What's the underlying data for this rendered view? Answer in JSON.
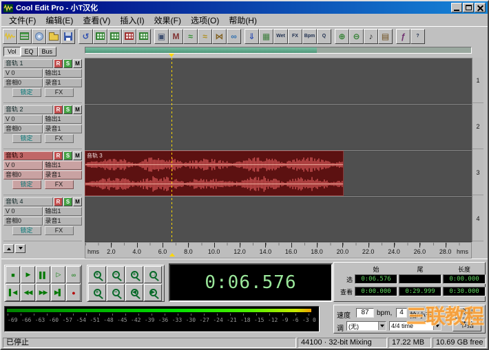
{
  "window": {
    "title": "Cool Edit Pro - 小T汉化"
  },
  "menu": {
    "items": [
      "文件(F)",
      "编辑(E)",
      "查看(V)",
      "插入(I)",
      "效果(F)",
      "选项(O)",
      "帮助(H)"
    ]
  },
  "toolbar": {
    "icons": [
      {
        "name": "waveform-view-icon",
        "kind": "wave",
        "color": "#e0c030"
      },
      {
        "name": "multitrack-view-icon",
        "kind": "bars"
      },
      {
        "name": "cd-project-view-icon",
        "kind": "disc"
      },
      {
        "name": "open-file-icon",
        "kind": "folder"
      },
      {
        "name": "save-session-icon",
        "kind": "floppy"
      },
      {
        "sep": true
      },
      {
        "name": "undo-icon",
        "kind": "glyph",
        "glyph": "↺",
        "color": "#3050b0"
      },
      {
        "name": "insert-wave-icon",
        "kind": "grid"
      },
      {
        "name": "clip-properties-icon",
        "kind": "grid"
      },
      {
        "name": "split-clip-icon",
        "kind": "gridred"
      },
      {
        "name": "merge-clip-icon",
        "kind": "grid"
      },
      {
        "sep": true
      },
      {
        "name": "lock-time-icon",
        "kind": "glyph",
        "glyph": "▣",
        "color": "#405070"
      },
      {
        "name": "mute-clip-icon",
        "kind": "glyph",
        "glyph": "M",
        "color": "#803030"
      },
      {
        "name": "volume-envelope-icon",
        "kind": "glyph",
        "glyph": "≈",
        "color": "#2f8f2f"
      },
      {
        "name": "pan-envelope-icon",
        "kind": "glyph",
        "glyph": "≈",
        "color": "#b09020"
      },
      {
        "name": "crossfade-icon",
        "kind": "glyph",
        "glyph": "⋈",
        "color": "#806020"
      },
      {
        "name": "loop-duplicate-icon",
        "kind": "glyph",
        "glyph": "∞",
        "color": "#2f6faf"
      },
      {
        "sep": true
      },
      {
        "name": "mixdown-icon",
        "kind": "glyph",
        "glyph": "⇓",
        "color": "#3050b0"
      },
      {
        "name": "mixer-icon",
        "kind": "glyph",
        "glyph": "▦",
        "color": "#3f7f3f"
      },
      {
        "name": "wet-dry-icon",
        "kind": "text",
        "glyph": "Wet",
        "color": "#203050"
      },
      {
        "name": "fx-rack-icon",
        "kind": "text",
        "glyph": "FX",
        "color": "#203050"
      },
      {
        "name": "bpm-icon",
        "kind": "text",
        "glyph": "Bpm",
        "color": "#203050"
      },
      {
        "name": "quantize-icon",
        "kind": "text",
        "glyph": "Q",
        "color": "#203050"
      },
      {
        "sep": true
      },
      {
        "name": "zoom-in-icon",
        "kind": "glyph",
        "glyph": "⊕",
        "color": "#2f7f2f"
      },
      {
        "name": "zoom-out-icon",
        "kind": "glyph",
        "glyph": "⊖",
        "color": "#2f7f2f"
      },
      {
        "name": "metronome-icon",
        "kind": "glyph",
        "glyph": "♪",
        "color": "#303030"
      },
      {
        "name": "cue-list-icon",
        "kind": "glyph",
        "glyph": "▤",
        "color": "#705020"
      },
      {
        "sep": true
      },
      {
        "name": "scripts-icon",
        "kind": "glyph",
        "glyph": "ƒ",
        "color": "#703070"
      },
      {
        "name": "help-icon",
        "kind": "text",
        "glyph": "?",
        "color": "#203050"
      }
    ]
  },
  "left_panel": {
    "tabs": [
      "Vol",
      "EQ",
      "Bus"
    ],
    "tracks": [
      {
        "name": "音轨 1",
        "record": "R",
        "solo": "S",
        "mute": "M",
        "volume": "V 0",
        "out": "输出1",
        "pan": "音相0",
        "rec": "录音1",
        "lock": "锁定",
        "fx": "FX",
        "selected": false
      },
      {
        "name": "音轨 2",
        "record": "R",
        "solo": "S",
        "mute": "M",
        "volume": "V 0",
        "out": "输出1",
        "pan": "音相0",
        "rec": "录音1",
        "lock": "锁定",
        "fx": "FX",
        "selected": false
      },
      {
        "name": "音轨 3",
        "record": "R",
        "solo": "S",
        "mute": "M",
        "volume": "V 0",
        "out": "输出1",
        "pan": "音相0",
        "rec": "录音1",
        "lock": "锁定",
        "fx": "FX",
        "selected": true
      },
      {
        "name": "音轨 4",
        "record": "R",
        "solo": "S",
        "mute": "M",
        "volume": "V 0",
        "out": "输出1",
        "pan": "音相0",
        "rec": "录音1",
        "lock": "锁定",
        "fx": "FX",
        "selected": false
      }
    ]
  },
  "track_view": {
    "clip": {
      "label": "音轨 3"
    },
    "ruler": {
      "unit_left": "hms",
      "unit_right": "hms",
      "total_seconds": 30,
      "ticks": [
        "2.0",
        "4.0",
        "6.0",
        "8.0",
        "10.0",
        "12.0",
        "14.0",
        "16.0",
        "18.0",
        "20.0",
        "22.0",
        "24.0",
        "26.0",
        "28.0"
      ]
    },
    "track_numbers": [
      "1",
      "2",
      "3",
      "4"
    ]
  },
  "transport": {
    "rows": [
      [
        {
          "name": "stop-button",
          "glyph": "■"
        },
        {
          "name": "play-button",
          "glyph": "▶"
        },
        {
          "name": "pause-button",
          "glyph": "▌▌"
        },
        {
          "name": "play-from-cursor-button",
          "glyph": "▷"
        },
        {
          "name": "play-looped-button",
          "glyph": "∞"
        }
      ],
      [
        {
          "name": "go-to-start-button",
          "glyph": "▌◀"
        },
        {
          "name": "rewind-button",
          "glyph": "◀◀"
        },
        {
          "name": "fast-forward-button",
          "glyph": "▶▶"
        },
        {
          "name": "go-to-end-button",
          "glyph": "▶▌"
        },
        {
          "name": "record-button",
          "glyph": "●",
          "color": "#b40000"
        }
      ]
    ]
  },
  "zoom": {
    "rows": [
      [
        {
          "name": "zoom-in-button",
          "sub": "+"
        },
        {
          "name": "zoom-out-button",
          "sub": "−"
        },
        {
          "name": "zoom-in-vertical-button",
          "sub": "+"
        },
        {
          "name": "zoom-full-button",
          "sub": "□"
        }
      ],
      [
        {
          "name": "zoom-to-selection-button",
          "sub": "+"
        },
        {
          "name": "zoom-out-full-button",
          "sub": "−"
        },
        {
          "name": "zoom-selection-left-button",
          "sub": "◀"
        },
        {
          "name": "zoom-selection-right-button",
          "sub": "▶"
        }
      ]
    ]
  },
  "time_display": {
    "value": "0:06.576"
  },
  "selection_panel": {
    "col_headers": [
      "始",
      "尾",
      "长度"
    ],
    "rows": [
      {
        "label": "选",
        "start": "0:06.576",
        "end": "",
        "length": "0:00.000"
      },
      {
        "label": "查看",
        "start": "0:00.000",
        "end": "0:29.999",
        "length": "0:30.000"
      }
    ]
  },
  "meter": {
    "scale": [
      "-69",
      "-66",
      "-63",
      "-60",
      "-57",
      "-54",
      "-51",
      "-48",
      "-45",
      "-42",
      "-39",
      "-36",
      "-33",
      "-30",
      "-27",
      "-24",
      "-21",
      "-18",
      "-15",
      "-12",
      "-9",
      "-6",
      "-3",
      "0"
    ]
  },
  "tempo_panel": {
    "speed_label": "速度",
    "speed_value": "87",
    "bpm_label": "bpm,",
    "beats_value": "4",
    "beats_label": "拍/小节",
    "advanced_button": "高级",
    "key_label": "调",
    "key_value": "(无)",
    "time_sig_value": "4/4 time",
    "metronome_button": "节拍"
  },
  "status_bar": {
    "state": "已停止",
    "format": "44100 · 32-bit Mixing",
    "memory": "17.22 MB",
    "disk": "10.69 GB free"
  },
  "watermark": {
    "text": "三联教程",
    "color": "#ff9c2a"
  }
}
